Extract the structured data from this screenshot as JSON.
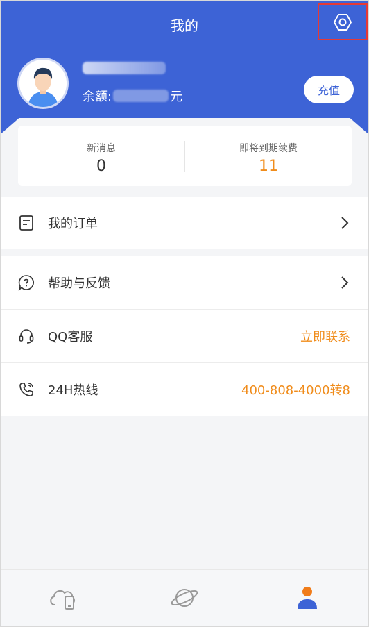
{
  "header": {
    "title": "我的",
    "settings_icon": "settings-hexagon-icon"
  },
  "profile": {
    "avatar_icon": "user-avatar-icon",
    "balance_label": "余额:",
    "balance_unit": "元",
    "recharge_label": "充值"
  },
  "stats": {
    "messages_label": "新消息",
    "messages_value": "0",
    "expiring_label": "即将到期续费",
    "expiring_value": "11"
  },
  "menu": {
    "orders_label": "我的订单",
    "help_label": "帮助与反馈",
    "qq_label": "QQ客服",
    "qq_action": "立即联系",
    "hotline_label": "24H热线",
    "hotline_number": "400-808-4000转8"
  },
  "tabs": [
    {
      "icon": "cloud-phone-icon"
    },
    {
      "icon": "planet-icon"
    },
    {
      "icon": "profile-icon"
    }
  ],
  "colors": {
    "primary": "#3d63d6",
    "accent": "#f08c1b",
    "highlight_box": "#e53935"
  }
}
